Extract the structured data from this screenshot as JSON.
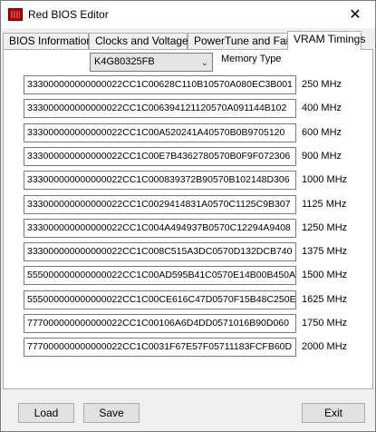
{
  "window": {
    "title": "Red BIOS Editor",
    "close_glyph": "✕"
  },
  "tabs": [
    {
      "label": "BIOS Information",
      "active": false
    },
    {
      "label": "Clocks and Voltages",
      "active": false
    },
    {
      "label": "PowerTune and Fans",
      "active": false
    },
    {
      "label": "VRAM Timings",
      "active": true
    }
  ],
  "memory": {
    "selected": "K4G80325FB",
    "label": "Memory Type"
  },
  "timings": [
    {
      "value": "333000000000000022CC1C00628C110B10570A080EC3B001",
      "freq": "250 MHz"
    },
    {
      "value": "333000000000000022CC1C006394121120570A091144B102",
      "freq": "400 MHz"
    },
    {
      "value": "333000000000000022CC1C00A520241A40570B0B9705120",
      "freq": "600 MHz"
    },
    {
      "value": "333000000000000022CC1C00E7B4362780570B0F9F072306",
      "freq": "900 MHz"
    },
    {
      "value": "333000000000000022CC1C000839372B90570B102148D306",
      "freq": "1000 MHz"
    },
    {
      "value": "333000000000000022CC1C0029414831A0570C1125C9B307",
      "freq": "1125 MHz"
    },
    {
      "value": "333000000000000022CC1C004A494937B0570C12294A9408",
      "freq": "1250 MHz"
    },
    {
      "value": "333000000000000022CC1C008C515A3DC0570D132DCB740",
      "freq": "1375 MHz"
    },
    {
      "value": "555000000000000022CC1C00AD595B41C0570E14B00B450A",
      "freq": "1500 MHz"
    },
    {
      "value": "555000000000000022CC1C00CE616C47D0570F15B48C250E",
      "freq": "1625 MHz"
    },
    {
      "value": "777000000000000022CC1C00106A6D4DD0571016B90D060",
      "freq": "1750 MHz"
    },
    {
      "value": "777000000000000022CC1C0031F67E57F05711183FCFB60D",
      "freq": "2000 MHz"
    }
  ],
  "buttons": {
    "load": "Load",
    "save": "Save",
    "exit": "Exit"
  },
  "colors": {
    "icon_red": "#b00000",
    "panel_bg": "#ffffff",
    "window_bg": "#f0f0f0"
  }
}
